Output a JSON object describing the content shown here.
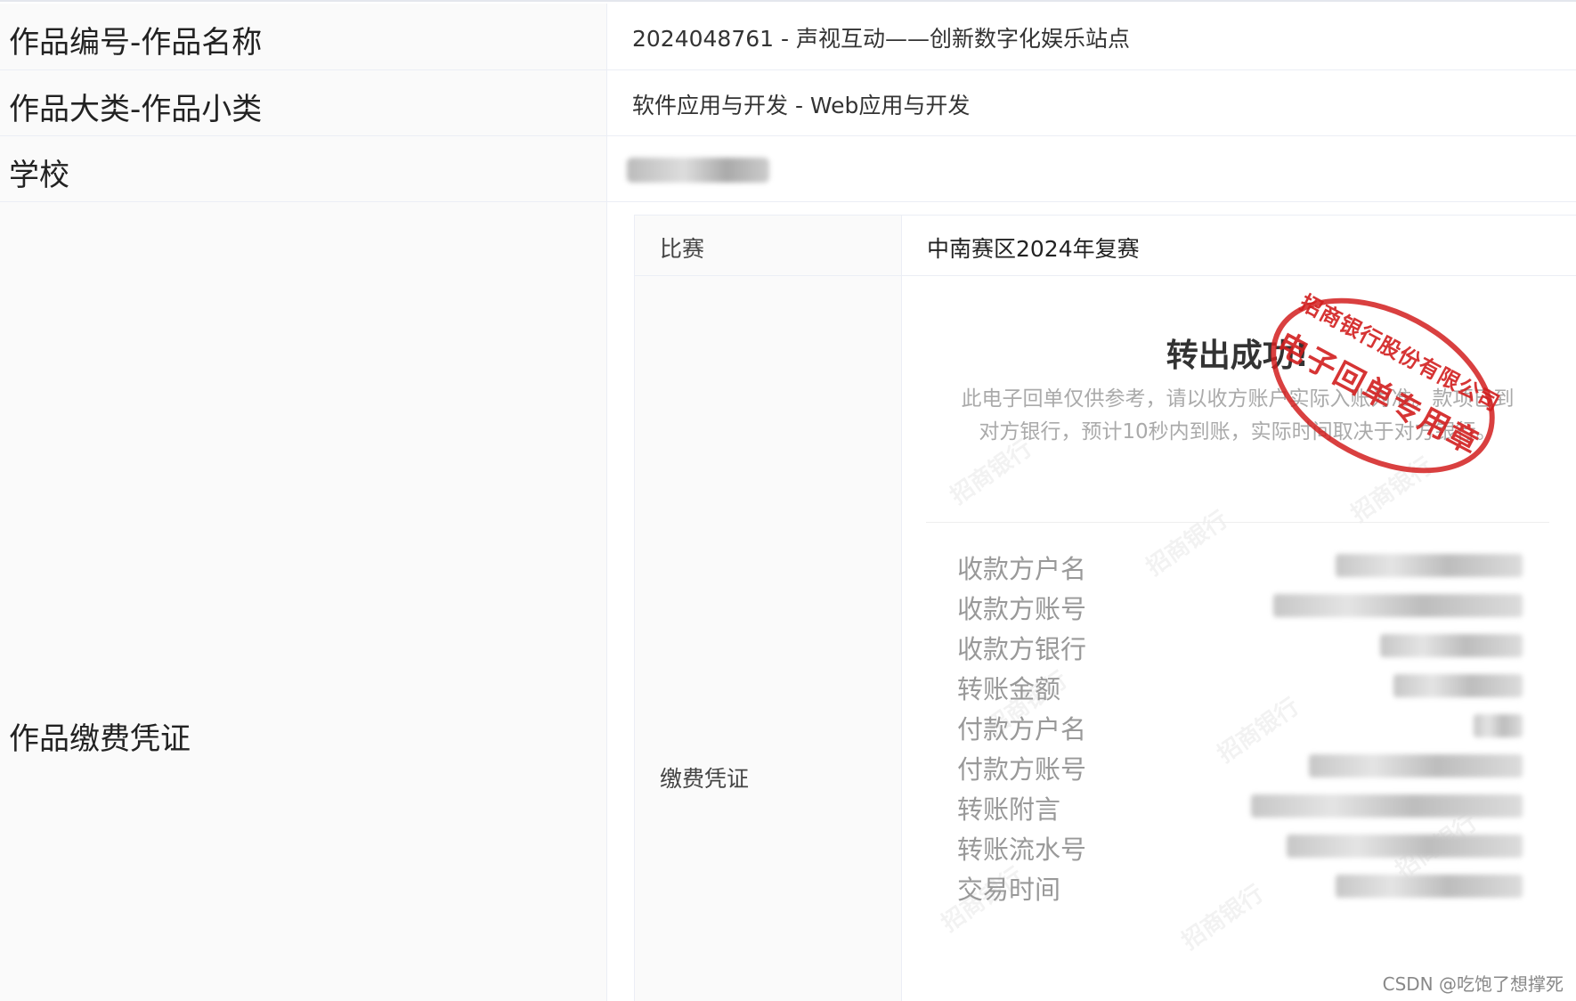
{
  "rows": [
    {
      "label": "作品编号-作品名称",
      "value": "2024048761 - 声视互动——创新数字化娱乐站点"
    },
    {
      "label": "作品大类-作品小类",
      "value": "软件应用与开发 - Web应用与开发"
    },
    {
      "label": "学校",
      "value": ""
    },
    {
      "label": "作品缴费凭证"
    }
  ],
  "inner": {
    "contest_label": "比赛",
    "contest_value": "中南赛区2024年复赛",
    "voucher_label": "缴费凭证"
  },
  "receipt": {
    "title": "转出成功!",
    "note": "此电子回单仅供参考，请以收方账户实际入账为准。款项已到对方银行，预计10秒内到账，实际时间取决于对方银行。",
    "fields": [
      "收款方户名",
      "收款方账号",
      "收款方银行",
      "转账金额",
      "付款方户名",
      "付款方账号",
      "转账附言",
      "转账流水号",
      "交易时间"
    ],
    "stamp_top": "招商银行股份有限公司",
    "stamp_mid": "电子回单专用章",
    "watermark": "招商银行"
  },
  "credit": "CSDN @吃饱了想撑死",
  "colors": {
    "stamp": "#d21e1e",
    "label_bg": "#fafafa",
    "border": "#ebeef5"
  }
}
